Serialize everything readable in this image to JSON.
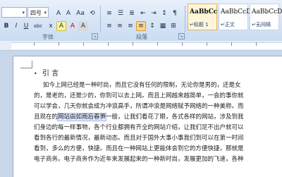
{
  "ribbon": {
    "font_size": "四号",
    "buttons": [
      "A",
      "A",
      "Aa",
      "⟲",
      "A",
      "B",
      "I",
      "U",
      "abc",
      "x",
      "A",
      "A",
      "A"
    ],
    "group_labels": {
      "font": "字体",
      "paragraph": "段落"
    },
    "styles": [
      {
        "sample": "AaBbCc",
        "name": "↵标题 1"
      },
      {
        "sample": "AaBbCcD",
        "name": "↵正文"
      },
      {
        "sample": "AaBbCcD",
        "name": "↵无间隔"
      }
    ]
  },
  "document": {
    "heading": "引 言",
    "lines": [
      "如今上网已经是一种时尚，而且它没有任何的限制，无论你是男的，还是女",
      "的，是老的，还是少的，你到可以去上网。而且上网越来越简单，一会的事你就",
      "可以学会，几天你就会成为冲浪高手，所谓冲浪是网络赋予网络的一种美称。而",
      "且现在的网站由如雨后春笋一般，让我们看花了眼，各式各样的网站，涉及到我",
      "们身边的每一样事物，各个行业都拥有齐全的网站介绍，让我们足不出户就可以",
      "看到各行的最新情况，最新动态。而且对于国外大事小事我们到可以在第一时间",
      "看到，多么的方便，快捷。而且在一种网站上更能体会到它的方便快捷，那就是",
      "电子商务。电子商务作为近年来发展起来的一种新时尚，发展更加的飞速，各种"
    ],
    "highlight_text": "网站由如雨后春笋"
  }
}
